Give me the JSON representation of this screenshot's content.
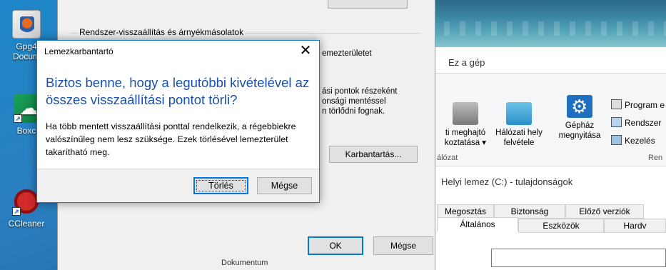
{
  "desktop": {
    "icons": [
      {
        "label": "Gpg4",
        "label2": "Docum"
      },
      {
        "label": "Boxcr"
      },
      {
        "label": "CCleaner"
      }
    ]
  },
  "system_properties": {
    "group_title": "Rendszer-visszaállítás és árnyékmásolatok",
    "text_partial_1": "emezterületet",
    "text_partial_2": "ási pontok részeként",
    "text_partial_3": "onsági mentéssel",
    "text_partial_4": "n törlődni fognak.",
    "cleanup_button": "Karbantartás...",
    "ok_button": "OK",
    "cancel_button": "Mégse"
  },
  "explorer": {
    "title": "Ez a gép",
    "ribbon": {
      "item1_line1": "ti meghajtó",
      "item1_line2": "koztatása ▾",
      "item2_line1": "Hálózati hely",
      "item2_line2": "felvétele",
      "item3_line1": "Gépház",
      "item3_line2": "megnyitása",
      "small1": "Program e",
      "small2": "Rendszer",
      "small3": "Kezelés",
      "section1": "álózat",
      "section2": "Ren"
    }
  },
  "properties": {
    "title": "Helyi lemez (C:) - tulajdonságok",
    "tabs_row1": [
      "Megosztás",
      "Biztonság",
      "Előző verziók"
    ],
    "tabs_row2": [
      "Általános",
      "Eszközök",
      "Hardv"
    ]
  },
  "taskbar_fragment": "Dokumentum",
  "dialog": {
    "title": "Lemezkarbantartó",
    "close_glyph": "✕",
    "heading": "Biztos benne, hogy a legutóbbi kivételével az összes visszaállítási pontot törli?",
    "body": "Ha több mentett visszaállítási ponttal rendelkezik, a régebbiekre valószínűleg nem lesz szüksége. Ezek törlésével lemezterület takarítható meg.",
    "delete_button": "Törlés",
    "cancel_button": "Mégse"
  }
}
